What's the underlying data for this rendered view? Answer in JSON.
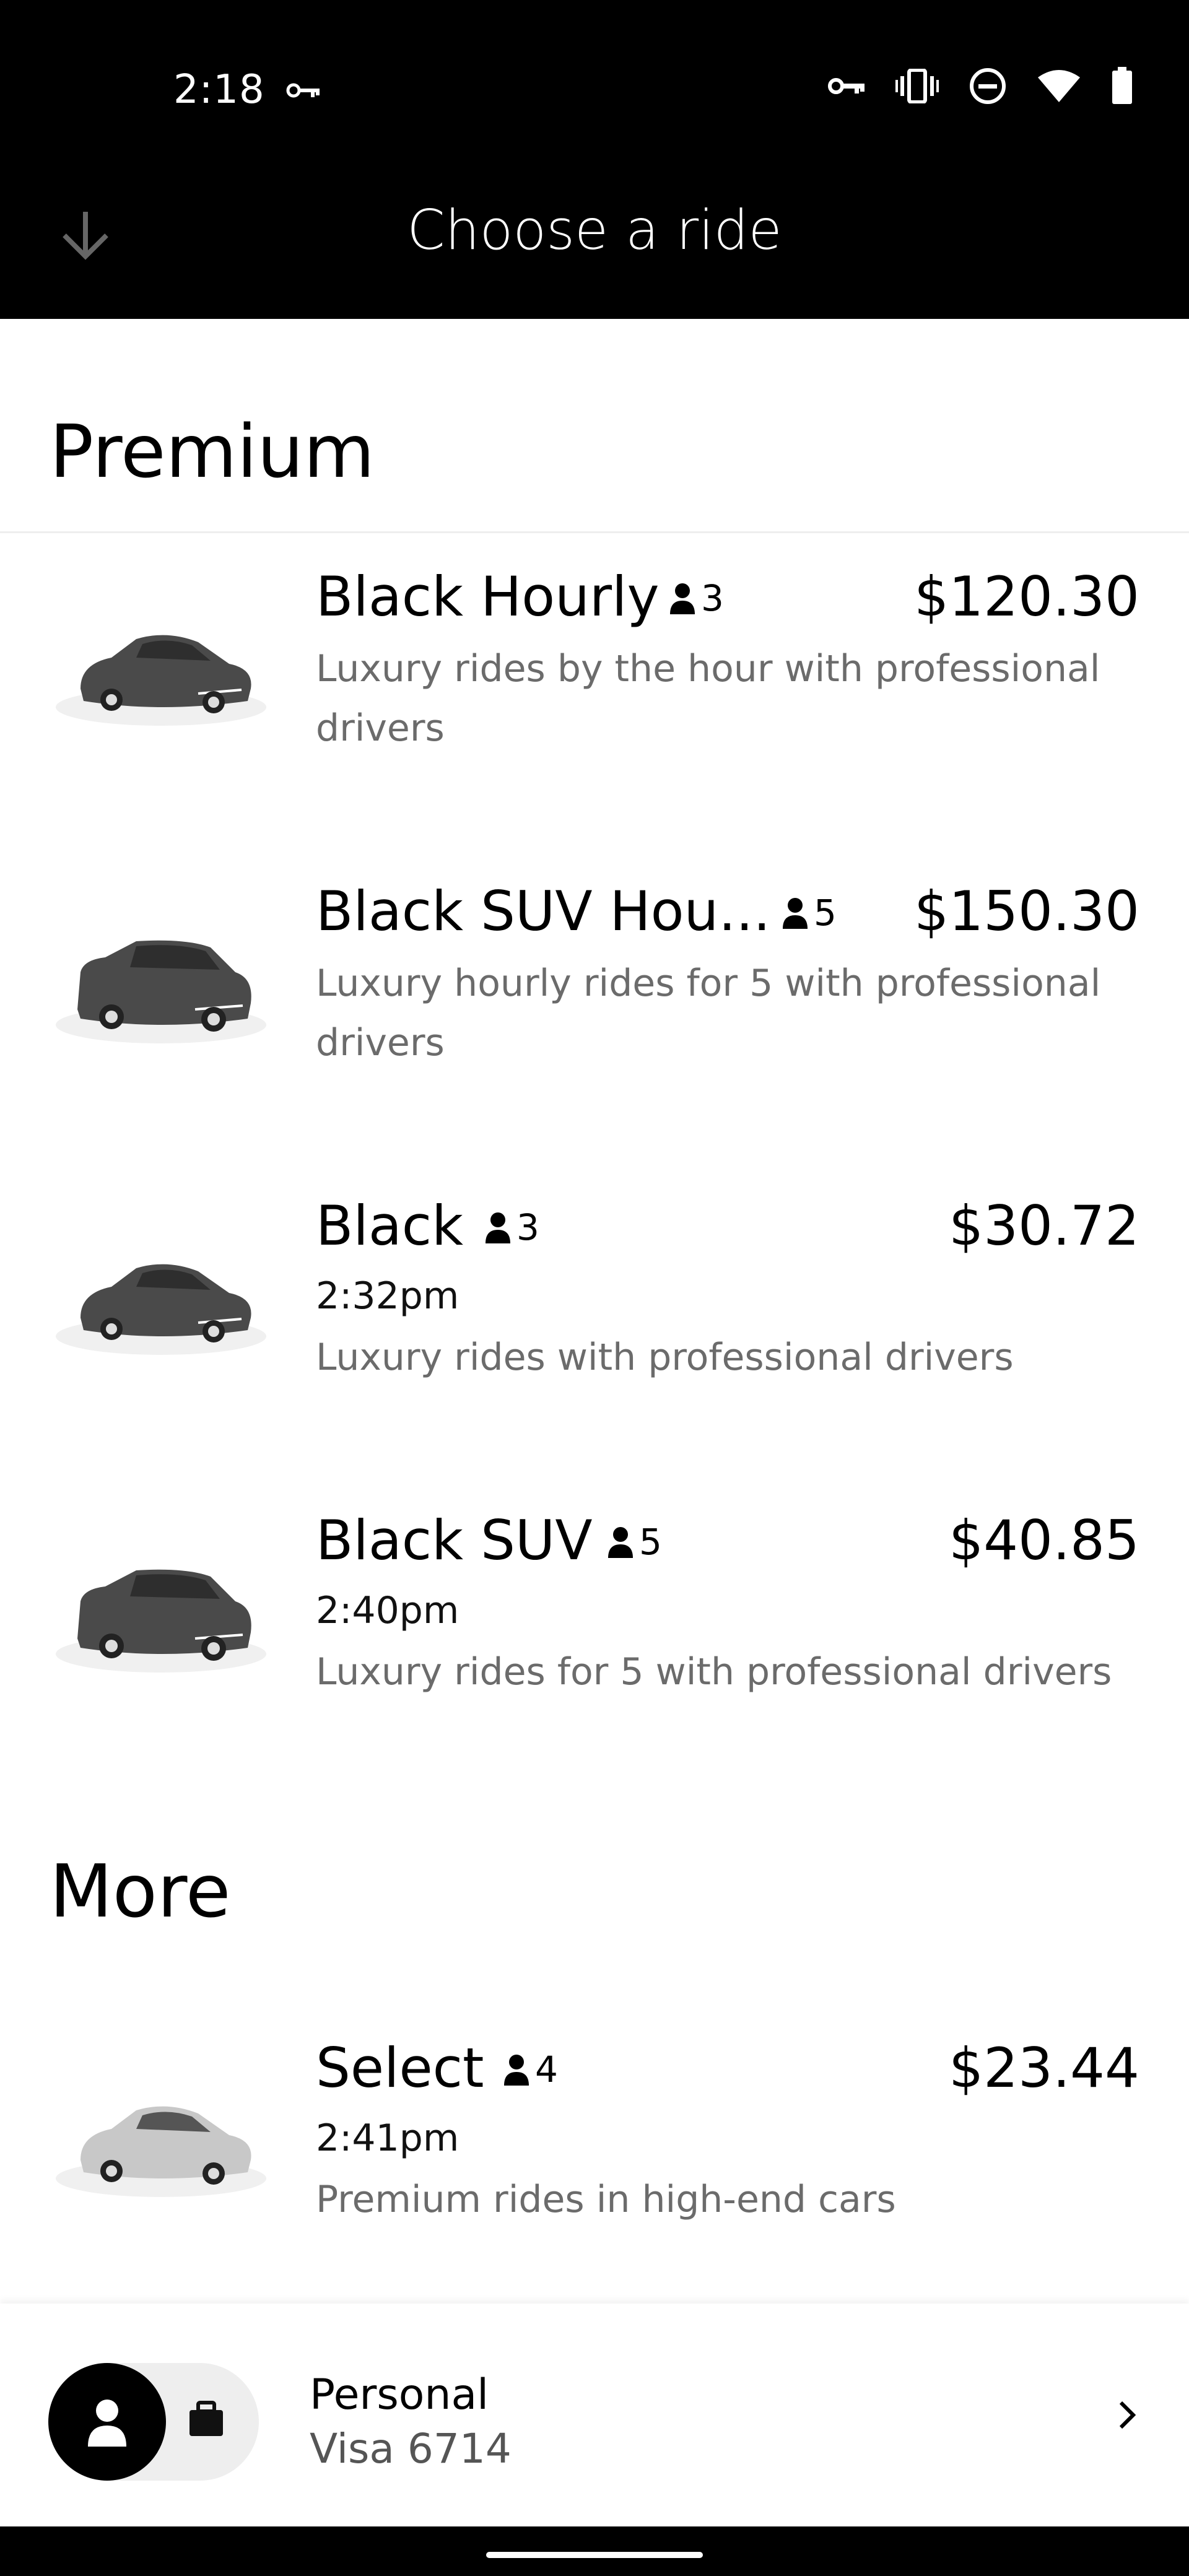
{
  "status_bar": {
    "time": "2:18",
    "icons": [
      "key-icon",
      "vpn-key-icon",
      "vibrate-icon",
      "do-not-disturb-icon",
      "wifi-icon",
      "battery-icon"
    ]
  },
  "header": {
    "title": "Choose a ride",
    "back_icon": "arrow-down-icon"
  },
  "sections": {
    "premium_title": "Premium",
    "more_title": "More"
  },
  "rides": [
    {
      "name": "Black Hourly",
      "capacity": "3",
      "price": "$120.30",
      "time": "",
      "desc": "Luxury rides by the hour with professional drivers"
    },
    {
      "name": "Black SUV Hou...",
      "capacity": "5",
      "price": "$150.30",
      "time": "",
      "desc": "Luxury hourly rides for 5 with professional drivers"
    },
    {
      "name": "Black",
      "capacity": "3",
      "price": "$30.72",
      "time": "2:32pm",
      "desc": "Luxury rides with professional drivers"
    },
    {
      "name": "Black SUV",
      "capacity": "5",
      "price": "$40.85",
      "time": "2:40pm",
      "desc": "Luxury rides for 5 with professional drivers"
    },
    {
      "name": "Select",
      "capacity": "4",
      "price": "$23.44",
      "time": "2:41pm",
      "desc": "Premium rides in high-end cars"
    }
  ],
  "payment": {
    "profile": "Personal",
    "card": "Visa 6714"
  },
  "colors": {
    "header_bg": "#000000",
    "desc_text": "#6b6b6b",
    "dark_car": "#4a4a4a",
    "light_car": "#c8c8c8"
  }
}
